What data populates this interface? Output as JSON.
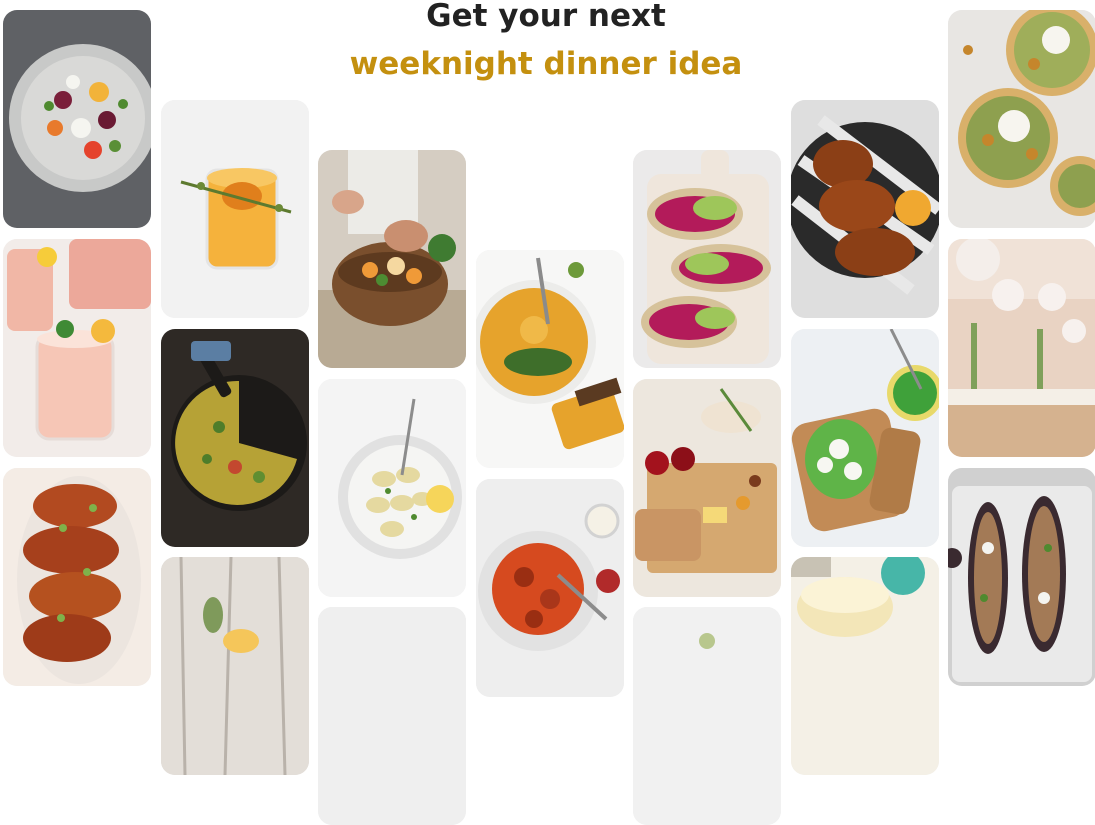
{
  "heading": {
    "line1": "Get your next",
    "line2": "weeknight dinner idea",
    "accent_color": "#c4900f"
  },
  "pins": [
    {
      "name": "beet-salad",
      "bg": "#5b5e63",
      "subject": "salad plate"
    },
    {
      "name": "pink-lemonade",
      "bg": "#f3ece8",
      "subject": "pink drinks"
    },
    {
      "name": "glazed-chicken",
      "bg": "#f6efe8",
      "subject": "glazed meat"
    },
    {
      "name": "citrus-cocktail",
      "bg": "#f1f1f1",
      "subject": "orange drink"
    },
    {
      "name": "herb-frittata",
      "bg": "#2f2b28",
      "subject": "frittata pan"
    },
    {
      "name": "rustic-table",
      "bg": "#d9d4cf",
      "subject": "wood table"
    },
    {
      "name": "bowl-prep",
      "bg": "#cfc8bd",
      "subject": "hands prepping bowl"
    },
    {
      "name": "tortellini",
      "bg": "#f3f3f3",
      "subject": "pasta bowl"
    },
    {
      "name": "hummus-bowl",
      "bg": "#f7f7f5",
      "subject": "squash hummus"
    },
    {
      "name": "spaghetti",
      "bg": "#eeeeee",
      "subject": "spaghetti plate"
    },
    {
      "name": "avocado-toast",
      "bg": "#ecebea",
      "subject": "beet avocado toast"
    },
    {
      "name": "charcuterie",
      "bg": "#eee9e1",
      "subject": "cheese board"
    },
    {
      "name": "grilled-chicken",
      "bg": "#dcdcdc",
      "subject": "grilled chicken"
    },
    {
      "name": "pea-toast",
      "bg": "#eef1f4",
      "subject": "pea toast"
    },
    {
      "name": "cheese-cake",
      "bg": "#f3efe4",
      "subject": "cheese wheel"
    },
    {
      "name": "chickpea-flatbread",
      "bg": "#e9e7e4",
      "subject": "flatbreads"
    },
    {
      "name": "party-venue",
      "bg": "#efe3da",
      "subject": "dining hall"
    },
    {
      "name": "stuffed-eggplant",
      "bg": "#cfcfcf",
      "subject": "eggplant tray"
    }
  ]
}
